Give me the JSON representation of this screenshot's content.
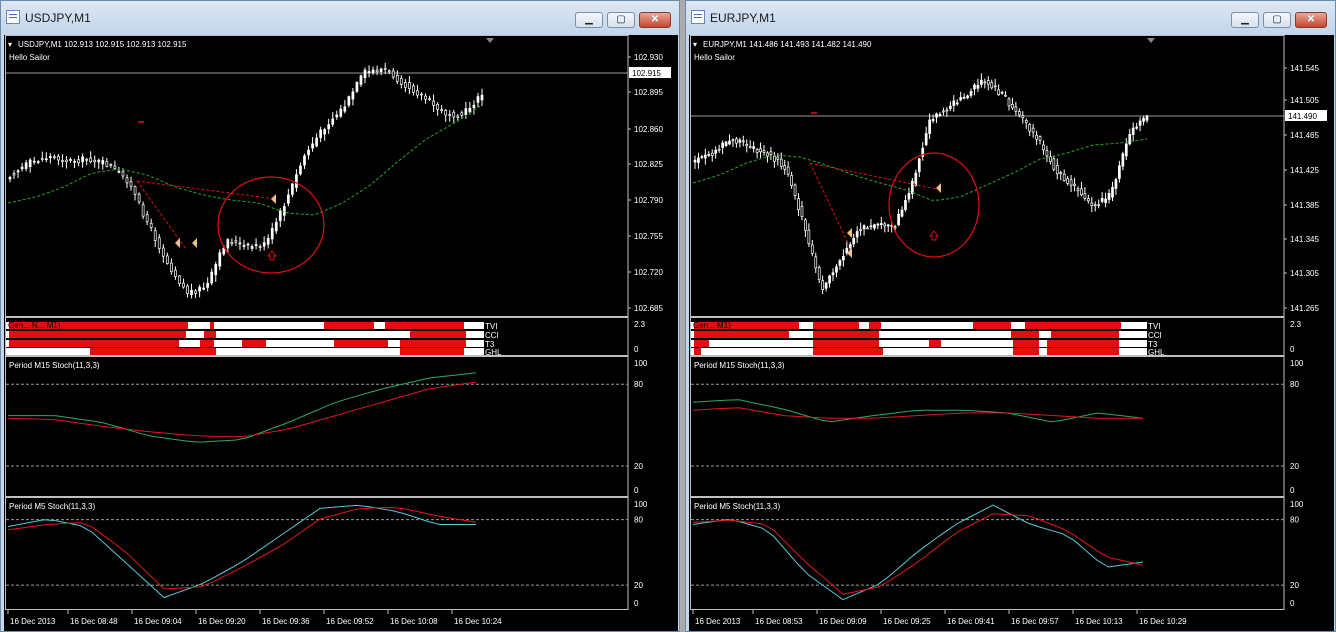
{
  "windows": [
    {
      "id": "left",
      "title": "USDJPY,M1",
      "buttons": {
        "minimize": "▁",
        "maximize": "▢",
        "close": "✕"
      },
      "header": "USDJPY,M1  102.913 102.915 102.913 102.915",
      "subtitle": "Hello Sailor",
      "price_axis": [
        "102.930",
        "102.915",
        "102.895",
        "102.860",
        "102.825",
        "102.790",
        "102.755",
        "102.720",
        "102.685"
      ],
      "current_price": "102.915",
      "indicator_label": "Gen... N... M1)",
      "indicator_rows": [
        "TVI",
        "CCI",
        "T3",
        "GHL"
      ],
      "indicator_axis": [
        "2.3",
        "0"
      ],
      "stoch1": {
        "label": "Period M15 Stoch(11,3,3)",
        "axis": [
          "100",
          "80",
          "20",
          "0"
        ]
      },
      "stoch2": {
        "label": "Period M5 Stoch(11,3,3)",
        "axis": [
          "100",
          "80",
          "20",
          "0"
        ]
      },
      "time_axis": [
        "16 Dec 2013",
        "16 Dec 08:48",
        "16 Dec 09:04",
        "16 Dec 09:20",
        "16 Dec 09:36",
        "16 Dec 09:52",
        "16 Dec 10:08",
        "16 Dec 10:24"
      ]
    },
    {
      "id": "right",
      "title": "EURJPY,M1",
      "buttons": {
        "minimize": "▁",
        "maximize": "▢",
        "close": "✕"
      },
      "header": "EURJPY,M1  141.486 141.493 141.482 141.490",
      "subtitle": "Hello Sailor",
      "price_axis": [
        "141.545",
        "141.505",
        "141.490",
        "141.465",
        "141.425",
        "141.385",
        "141.345",
        "141.305",
        "141.265"
      ],
      "current_price": "141.490",
      "indicator_label": "Gen... M1)",
      "indicator_rows": [
        "TVI",
        "CCI",
        "T3",
        "GHL"
      ],
      "indicator_axis": [
        "2.3",
        "0"
      ],
      "stoch1": {
        "label": "Period M15 Stoch(11,3,3)",
        "axis": [
          "100",
          "80",
          "20",
          "0"
        ]
      },
      "stoch2": {
        "label": "Period M5 Stoch(11,3,3)",
        "axis": [
          "100",
          "80",
          "20",
          "0"
        ]
      },
      "time_axis": [
        "16 Dec 2013",
        "16 Dec 08:53",
        "16 Dec 09:09",
        "16 Dec 09:25",
        "16 Dec 09:41",
        "16 Dec 09:57",
        "16 Dec 10:13",
        "16 Dec 10:29"
      ]
    }
  ],
  "colors": {
    "bull": "#ffffff",
    "bear": "#ffffff",
    "ma": "#22a822",
    "signal": "#e01010",
    "stoch_main": "#2fa86a",
    "stoch_signal": "#e01818",
    "cyan": "#58c8d8"
  }
}
